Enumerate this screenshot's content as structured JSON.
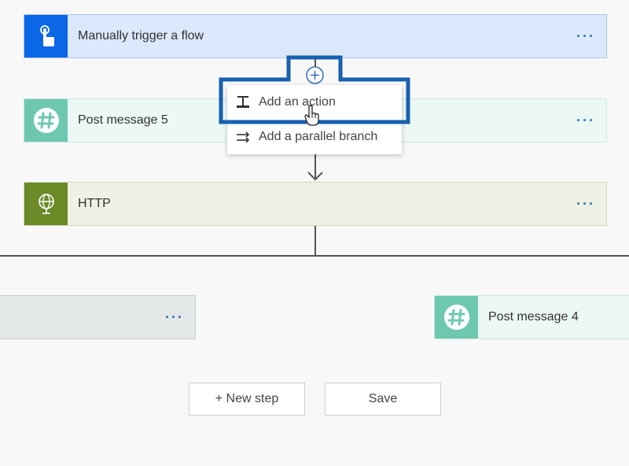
{
  "flow": {
    "trigger": {
      "title": "Manually trigger a flow",
      "more_label": "···",
      "icon": "touch-icon",
      "color": "#0a67e6"
    },
    "step1": {
      "title": "Post message 5",
      "more_label": "···",
      "icon": "slack-hash-icon",
      "color": "#6ec8b0"
    },
    "step2": {
      "title": "HTTP",
      "more_label": "···",
      "icon": "globe-icon",
      "color": "#6b8a28"
    },
    "branch_left": {
      "more_label": "···"
    },
    "branch_right": {
      "title": "Post message 4",
      "icon": "slack-hash-icon"
    }
  },
  "insert_menu": {
    "add_action_label": "Add an action",
    "add_parallel_label": "Add a parallel branch"
  },
  "footer": {
    "new_step_label": "+ New step",
    "save_label": "Save"
  },
  "colors": {
    "highlight": "#1760b0",
    "accent_dots": "#2b6fb8"
  }
}
